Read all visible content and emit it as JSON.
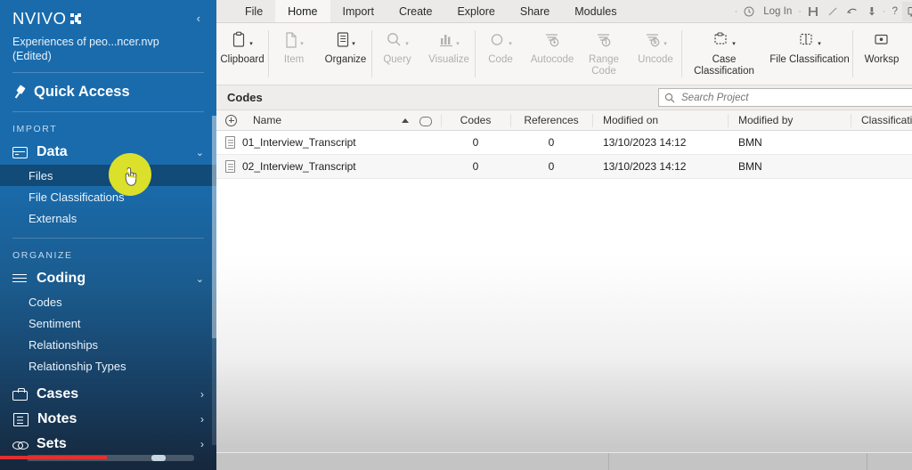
{
  "sidebar": {
    "logo": "NVIVO",
    "project_name": "Experiences of peo...ncer.nvp",
    "project_state": "(Edited)",
    "collapse_glyph": "‹",
    "quick_access": "Quick Access",
    "sections": [
      {
        "label": "IMPORT",
        "groups": [
          {
            "title": "Data",
            "icon": "data-icon",
            "expanded": true,
            "chevron": "⌄",
            "children": [
              {
                "label": "Files",
                "active": true
              },
              {
                "label": "File Classifications",
                "active": false
              },
              {
                "label": "Externals",
                "active": false
              }
            ]
          }
        ]
      },
      {
        "label": "ORGANIZE",
        "groups": [
          {
            "title": "Coding",
            "icon": "coding-icon",
            "expanded": true,
            "chevron": "⌄",
            "children": [
              {
                "label": "Codes",
                "active": false
              },
              {
                "label": "Sentiment",
                "active": false
              },
              {
                "label": "Relationships",
                "active": false
              },
              {
                "label": "Relationship Types",
                "active": false
              }
            ]
          },
          {
            "title": "Cases",
            "icon": "cases-icon",
            "expanded": false,
            "chevron": "›",
            "children": []
          },
          {
            "title": "Notes",
            "icon": "notes-icon",
            "expanded": false,
            "chevron": "›",
            "children": []
          },
          {
            "title": "Sets",
            "icon": "sets-icon",
            "expanded": false,
            "chevron": "›",
            "children": []
          }
        ]
      }
    ]
  },
  "titlebar": {
    "tabs": [
      {
        "label": "File",
        "active": false
      },
      {
        "label": "Home",
        "active": true
      },
      {
        "label": "Import",
        "active": false
      },
      {
        "label": "Create",
        "active": false
      },
      {
        "label": "Explore",
        "active": false
      },
      {
        "label": "Share",
        "active": false
      },
      {
        "label": "Modules",
        "active": false
      }
    ],
    "login_label": "Log In",
    "quick_icons": [
      "account-icon",
      "save-icon",
      "edit-icon",
      "undo-icon",
      "redo-dropdown-icon",
      "help-icon",
      "comment-icon"
    ],
    "help_glyph": "?",
    "minimize_glyph": "–",
    "maximize_glyph": "□"
  },
  "ribbon": {
    "groups": [
      {
        "buttons": [
          {
            "label": "Clipboard",
            "icon": "clipboard-icon",
            "disabled": false,
            "caret": true
          }
        ]
      },
      {
        "buttons": [
          {
            "label": "Item",
            "icon": "item-icon",
            "disabled": true,
            "caret": true
          },
          {
            "label": "Organize",
            "icon": "organize-icon",
            "disabled": false,
            "caret": true
          }
        ]
      },
      {
        "buttons": [
          {
            "label": "Query",
            "icon": "query-icon",
            "disabled": true,
            "caret": true
          },
          {
            "label": "Visualize",
            "icon": "visualize-icon",
            "disabled": true,
            "caret": true
          }
        ]
      },
      {
        "buttons": [
          {
            "label": "Code",
            "icon": "code-icon",
            "disabled": true,
            "caret": true
          },
          {
            "label": "Autocode",
            "icon": "autocode-icon",
            "disabled": true,
            "caret": false
          },
          {
            "label": "Range Code",
            "icon": "range-code-icon",
            "disabled": true,
            "caret": false
          },
          {
            "label": "Uncode",
            "icon": "uncode-icon",
            "disabled": true,
            "caret": true
          }
        ]
      },
      {
        "buttons": [
          {
            "label": "Case Classification",
            "icon": "case-classification-icon",
            "disabled": false,
            "caret": true
          },
          {
            "label": "File Classification",
            "icon": "file-classification-icon",
            "disabled": false,
            "caret": true
          }
        ]
      },
      {
        "buttons": [
          {
            "label": "Worksp",
            "icon": "workspace-icon",
            "disabled": false,
            "caret": false
          }
        ]
      }
    ]
  },
  "view": {
    "title": "Codes",
    "search_placeholder": "Search Project",
    "search_value": ""
  },
  "table": {
    "columns": [
      {
        "key": "name",
        "label": "Name"
      },
      {
        "key": "codes",
        "label": "Codes"
      },
      {
        "key": "references",
        "label": "References"
      },
      {
        "key": "modified_on",
        "label": "Modified on"
      },
      {
        "key": "modified_by",
        "label": "Modified by"
      },
      {
        "key": "classification",
        "label": "Classification"
      }
    ],
    "sort_indicator": "ascending",
    "rows": [
      {
        "name": "01_Interview_Transcript",
        "codes": "0",
        "references": "0",
        "modified_on": "13/10/2023 14:12",
        "modified_by": "BMN",
        "classification": ""
      },
      {
        "name": "02_Interview_Transcript",
        "codes": "0",
        "references": "0",
        "modified_on": "13/10/2023 14:12",
        "modified_by": "BMN",
        "classification": ""
      }
    ]
  },
  "colors": {
    "sidebar_top": "#1a6bac",
    "sidebar_bottom": "#15273b",
    "cursor_highlight": "#dbe02a",
    "progress_red": "#e03131",
    "active_item": "rgba(0,0,0,.30)"
  }
}
